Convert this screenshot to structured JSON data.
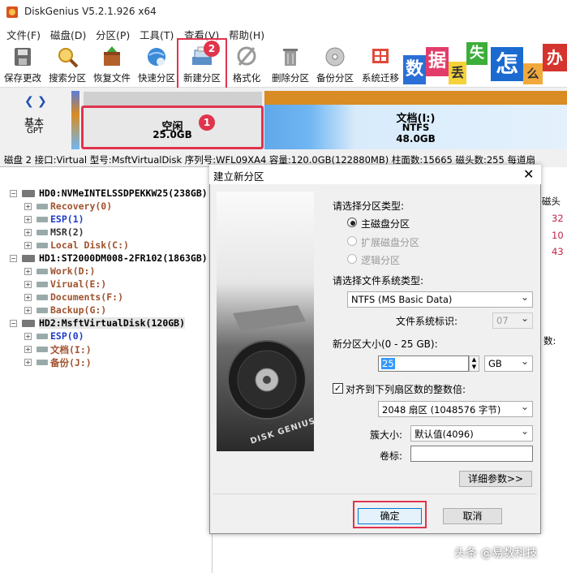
{
  "window": {
    "title": "DiskGenius V5.2.1.926 x64"
  },
  "menu": [
    "文件(F)",
    "磁盘(D)",
    "分区(P)",
    "工具(T)",
    "查看(V)",
    "帮助(H)"
  ],
  "toolbar": {
    "buttons": [
      {
        "label": "保存更改",
        "icon": "save-disk-icon"
      },
      {
        "label": "搜索分区",
        "icon": "magnifier-icon"
      },
      {
        "label": "恢复文件",
        "icon": "restore-box-icon"
      },
      {
        "label": "快速分区",
        "icon": "globe-icon"
      },
      {
        "label": "新建分区",
        "icon": "new-partition-icon"
      },
      {
        "label": "格式化",
        "icon": "format-icon"
      },
      {
        "label": "删除分区",
        "icon": "trash-icon"
      },
      {
        "label": "备份分区",
        "icon": "backup-cd-icon"
      },
      {
        "label": "系统迁移",
        "icon": "windows-migrate-icon"
      }
    ],
    "step_badge": "2",
    "banner_chars": [
      "数",
      "据",
      "丢",
      "失",
      "怎",
      "么",
      "办"
    ]
  },
  "diskmap": {
    "type_label": "基本",
    "scheme": "GPT",
    "free": {
      "name": "空闲",
      "size": "25.0GB",
      "badge": "1"
    },
    "data_part": {
      "name": "文档(I:)",
      "fs": "NTFS",
      "size": "48.0GB"
    }
  },
  "disk_info": "磁盘 2 接口:Virtual  型号:MsftVirtualDisk  序列号:WFL09XA4  容量:120.0GB(122880MB)  柱面数:15665  磁头数:255  每道扇",
  "tree": [
    {
      "label": "HD0:NVMeINTELSSDPEKKW25(238GB)",
      "level": 0,
      "kind": "disk",
      "color": "#000000"
    },
    {
      "label": "Recovery(0)",
      "level": 1,
      "kind": "part",
      "color": "#a0522d"
    },
    {
      "label": "ESP(1)",
      "level": 1,
      "kind": "part",
      "color": "#1e3cc8"
    },
    {
      "label": "MSR(2)",
      "level": 1,
      "kind": "part",
      "color": "#333333"
    },
    {
      "label": "Local Disk(C:)",
      "level": 1,
      "kind": "part",
      "color": "#a0522d"
    },
    {
      "label": "HD1:ST2000DM008-2FR102(1863GB)",
      "level": 0,
      "kind": "disk",
      "color": "#000000"
    },
    {
      "label": "Work(D:)",
      "level": 1,
      "kind": "part",
      "color": "#a0522d"
    },
    {
      "label": "Virual(E:)",
      "level": 1,
      "kind": "part",
      "color": "#a0522d"
    },
    {
      "label": "Documents(F:)",
      "level": 1,
      "kind": "part",
      "color": "#a0522d"
    },
    {
      "label": "Backup(G:)",
      "level": 1,
      "kind": "part",
      "color": "#a0522d"
    },
    {
      "label": "HD2:MsftVirtualDisk(120GB)",
      "level": 0,
      "kind": "disk",
      "color": "#000000",
      "selected": true
    },
    {
      "label": "ESP(0)",
      "level": 1,
      "kind": "part",
      "color": "#1e3cc8"
    },
    {
      "label": "文档(I:)",
      "level": 1,
      "kind": "part",
      "color": "#a0522d"
    },
    {
      "label": "备份(J:)",
      "level": 1,
      "kind": "part",
      "color": "#a0522d"
    }
  ],
  "right_pane": {
    "col_header": "磁头",
    "values": [
      "32",
      "10",
      "43"
    ],
    "note": "数:"
  },
  "dialog": {
    "title": "建立新分区",
    "close": "✕",
    "image_text": "DISK GENIUS",
    "part_type_label": "请选择分区类型:",
    "part_types": [
      {
        "label": "主磁盘分区",
        "checked": true,
        "enabled": true
      },
      {
        "label": "扩展磁盘分区",
        "checked": false,
        "enabled": false
      },
      {
        "label": "逻辑分区",
        "checked": false,
        "enabled": false
      }
    ],
    "fs_type_label": "请选择文件系统类型:",
    "fs_type_value": "NTFS (MS Basic Data)",
    "fs_id_label": "文件系统标识:",
    "fs_id_value": "07",
    "size_label": "新分区大小(0 - 25 GB):",
    "size_value": "25",
    "size_unit": "GB",
    "align_label": "对齐到下列扇区数的整数倍:",
    "align_checked": true,
    "align_value": "2048 扇区 (1048576 字节)",
    "cluster_label": "簇大小:",
    "cluster_value": "默认值(4096)",
    "volume_label": "卷标:",
    "volume_value": "",
    "details_button": "详细参数>>",
    "ok_button": "确定",
    "cancel_button": "取消"
  },
  "watermark": "头条 @易数科技",
  "colors": {
    "highlight": "#e0344d",
    "data_part_header": "#d98b24",
    "partition_fill": "#6fb6f2"
  }
}
